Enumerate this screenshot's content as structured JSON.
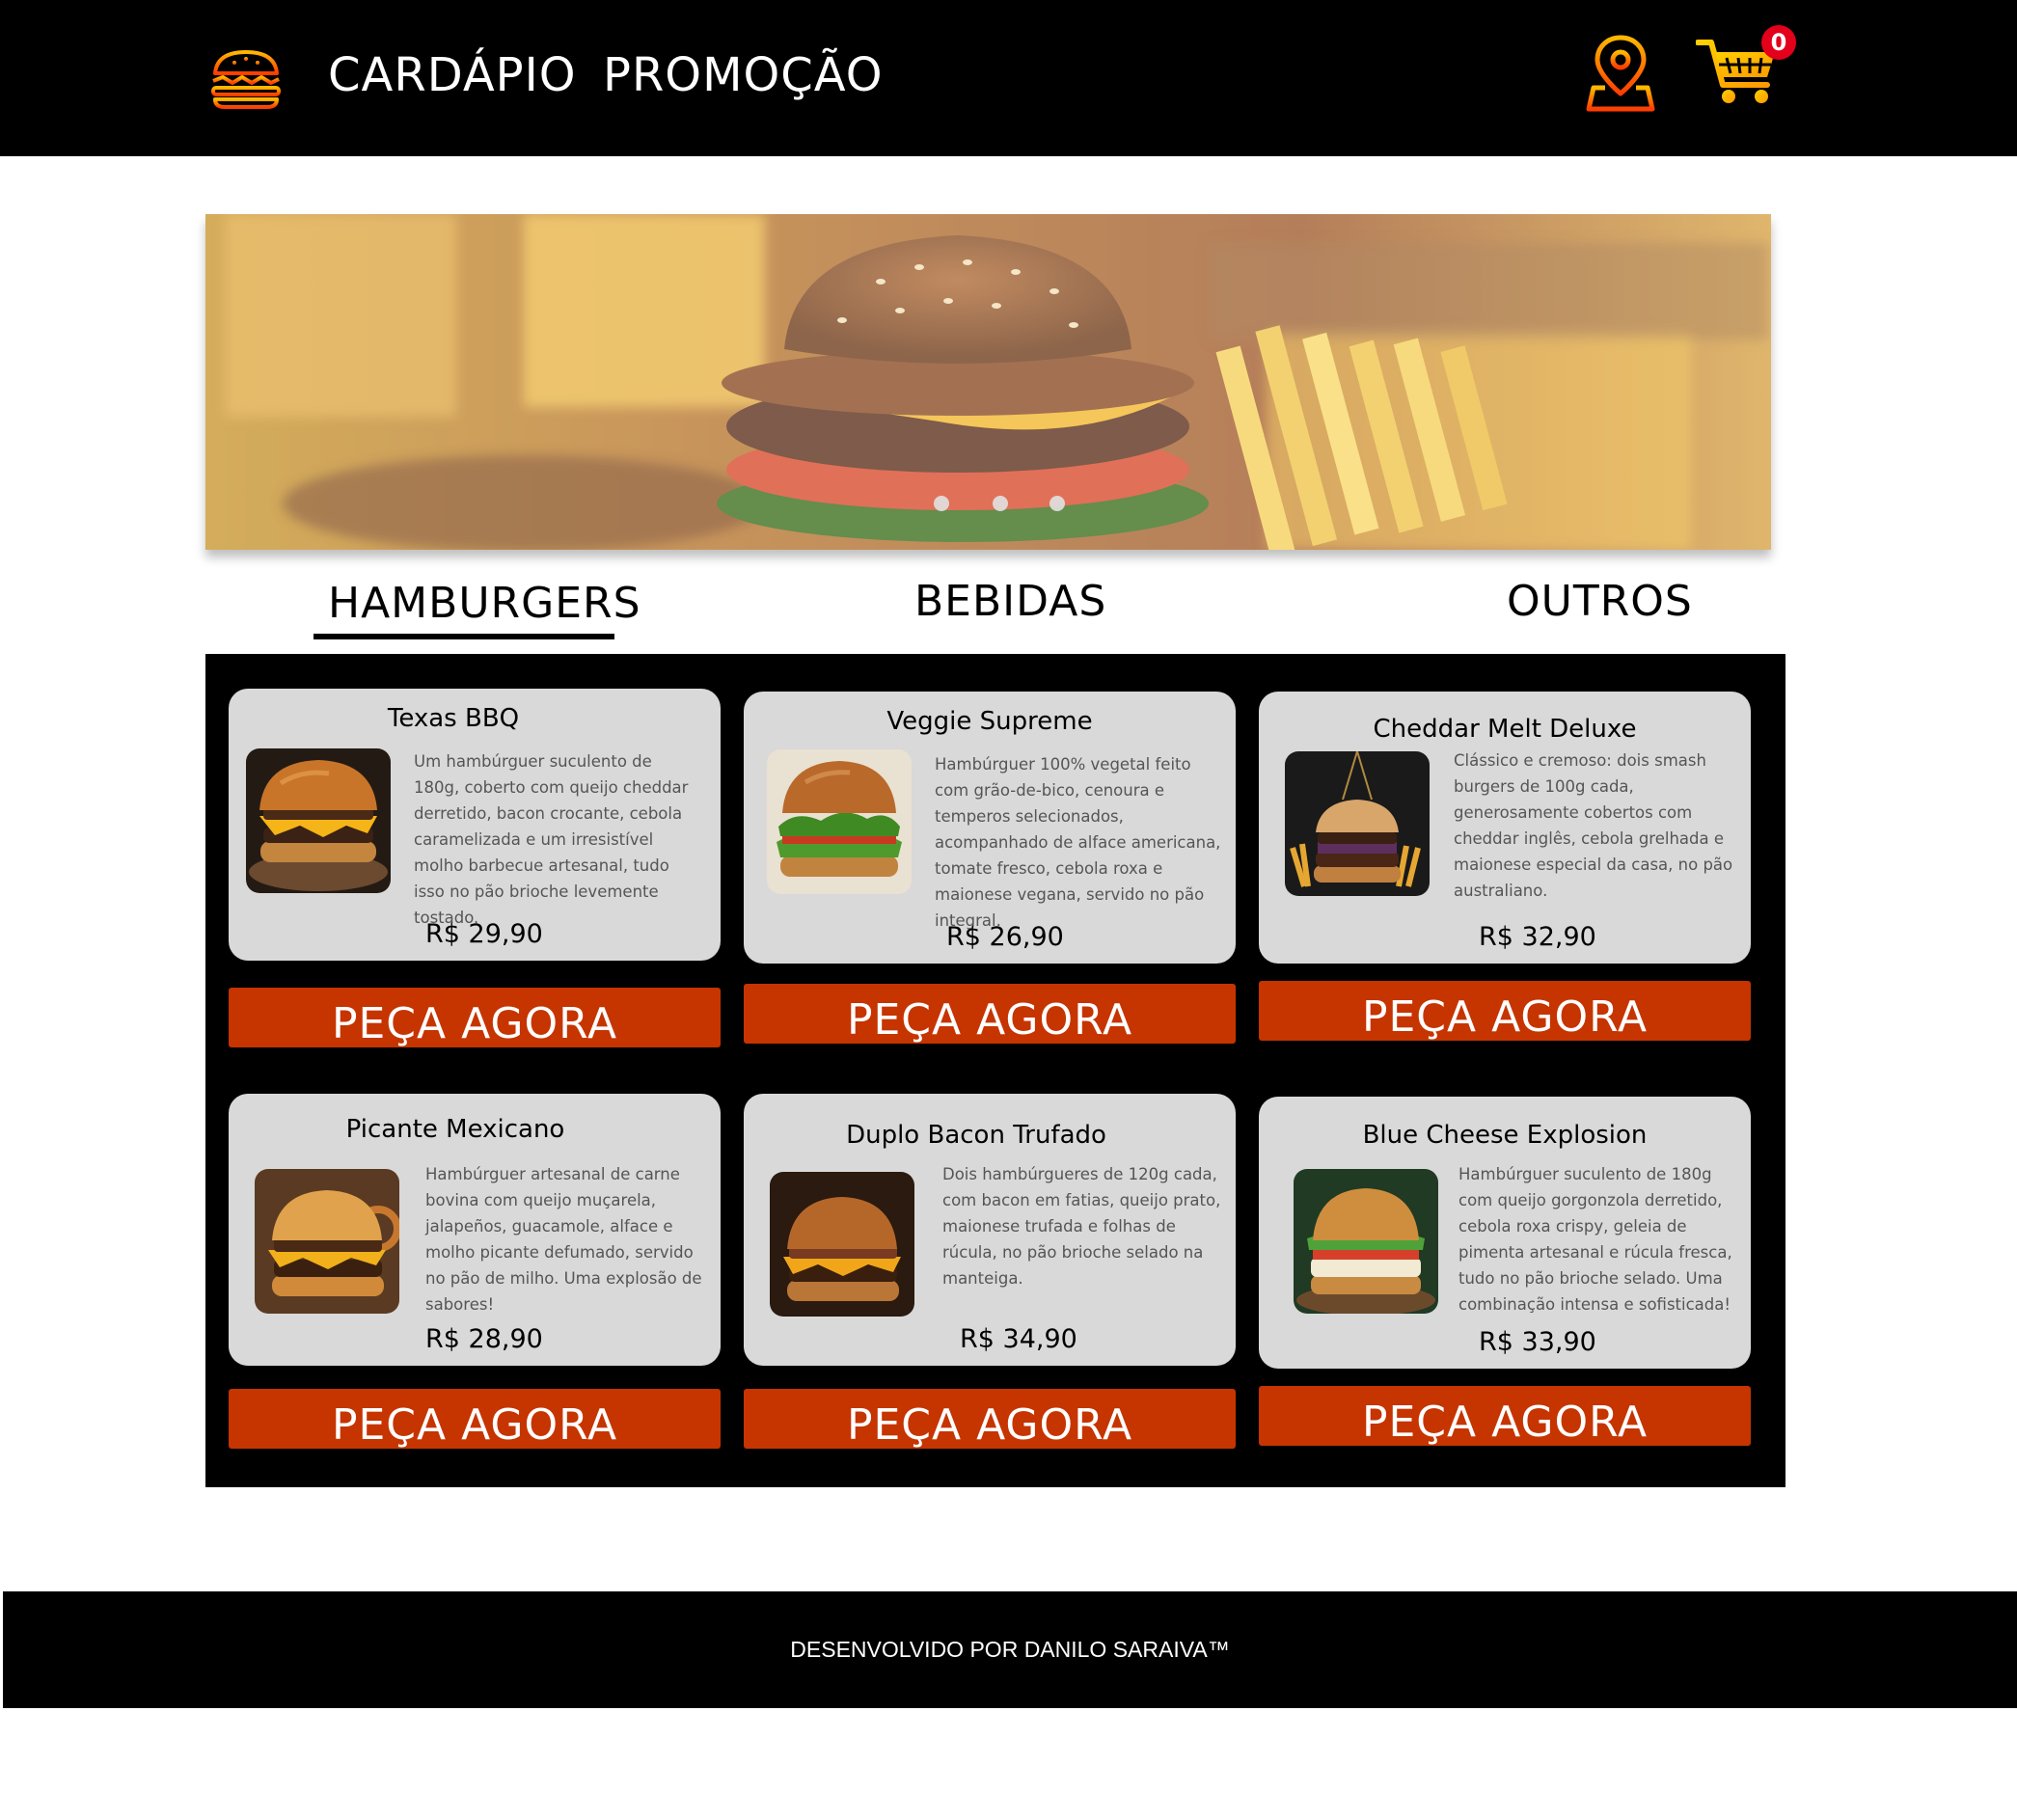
{
  "header": {
    "nav": [
      "CARDÁPIO",
      "PROMOÇÃO"
    ],
    "logo_icon": "burger-icon",
    "location_icon": "map-pin-icon",
    "cart_icon": "shopping-cart-icon",
    "cart_count": "0"
  },
  "hero": {
    "image": "burger-with-fries-and-beer-photo",
    "slides": 3
  },
  "categories": [
    "HAMBURGERS",
    "BEBIDAS",
    "OUTROS"
  ],
  "products": [
    {
      "name": "Texas BBQ",
      "description": "Um hambúrguer suculento de 180g, coberto com queijo cheddar derretido, bacon crocante, cebola caramelizada e um irresistível molho barbecue artesanal, tudo isso no pão brioche levemente tostado.",
      "price": "R$ 29,90",
      "button": "PEÇA AGORA"
    },
    {
      "name": "Veggie Supreme",
      "description": "Hambúrguer 100% vegetal feito com grão-de-bico, cenoura e temperos selecionados, acompanhado de alface americana, tomate fresco, cebola roxa e maionese vegana, servido no pão integral.",
      "price": "R$ 26,90",
      "button": "PEÇA AGORA"
    },
    {
      "name": "Cheddar Melt Deluxe",
      "description": "Clássico e cremoso: dois smash burgers de 100g cada, generosamente cobertos com cheddar inglês, cebola grelhada e maionese especial da casa, no pão australiano.",
      "price": "R$ 32,90",
      "button": "PEÇA AGORA"
    },
    {
      "name": "Picante Mexicano",
      "description": "Hambúrguer artesanal de carne bovina com queijo muçarela, jalapeños, guacamole, alface e molho picante defumado, servido no pão de milho. Uma explosão de sabores!",
      "price": "R$ 28,90",
      "button": "PEÇA AGORA"
    },
    {
      "name": "Duplo Bacon Trufado",
      "description": "Dois hambúrgueres de 120g cada, com bacon em fatias, queijo prato, maionese trufada e folhas de rúcula, no pão brioche selado na manteiga.",
      "price": "R$ 34,90",
      "button": "PEÇA AGORA"
    },
    {
      "name": "Blue Cheese Explosion",
      "description": "Hambúrguer suculento de 180g com queijo gorgonzola derretido, cebola roxa crispy, geleia de pimenta artesanal e rúcula fresca, tudo no pão brioche selado. Uma combinação intensa e sofisticada!",
      "price": "R$ 33,90",
      "button": "PEÇA AGORA"
    }
  ],
  "footer": {
    "text": "DESENVOLVIDO POR DANILO SARAIVA™"
  },
  "colors": {
    "header_bg": "#000000",
    "card_bg": "#d9d9d9",
    "button_bg": "#c63400",
    "icon_gradient": [
      "#ffb800",
      "#ff3d00"
    ],
    "badge": "#e3001b"
  }
}
